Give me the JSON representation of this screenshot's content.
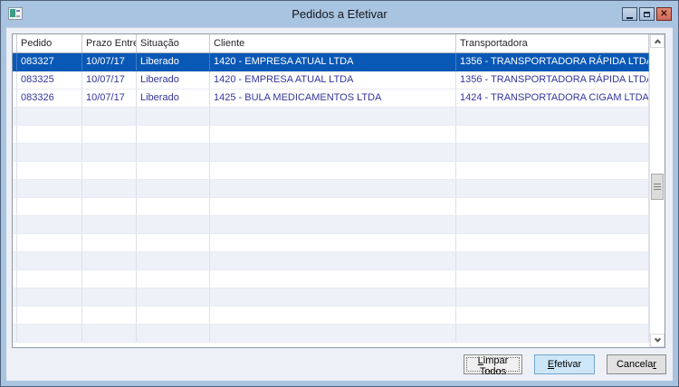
{
  "window": {
    "title": "Pedidos a Efetivar",
    "close_glyph": "✕"
  },
  "table": {
    "columns": [
      {
        "key": "indicator",
        "label": ""
      },
      {
        "key": "pedido",
        "label": "Pedido"
      },
      {
        "key": "prazo_entrega",
        "label": "Prazo Entrega"
      },
      {
        "key": "situacao",
        "label": "Situação"
      },
      {
        "key": "cliente",
        "label": "Cliente"
      },
      {
        "key": "transportadora",
        "label": "Transportadora"
      }
    ],
    "rows": [
      {
        "pedido": "083327",
        "prazo_entrega": "10/07/17",
        "situacao": "Liberado",
        "cliente": "1420 - EMPRESA ATUAL LTDA",
        "transportadora": "1356 - TRANSPORTADORA RÁPIDA LTDA",
        "selected": true
      },
      {
        "pedido": "083325",
        "prazo_entrega": "10/07/17",
        "situacao": "Liberado",
        "cliente": "1420 - EMPRESA ATUAL LTDA",
        "transportadora": "1356 - TRANSPORTADORA RÁPIDA LTDA",
        "selected": false
      },
      {
        "pedido": "083326",
        "prazo_entrega": "10/07/17",
        "situacao": "Liberado",
        "cliente": "1425 - BULA MEDICAMENTOS LTDA",
        "transportadora": "1424 - TRANSPORTADORA CIGAM LTDA",
        "selected": false
      }
    ],
    "empty_row_count": 13
  },
  "buttons": {
    "limpar_todos": {
      "pre": "",
      "accel": "L",
      "post": "impar Todos"
    },
    "efetivar": {
      "pre": "",
      "accel": "E",
      "post": "fetivar"
    },
    "cancelar": {
      "pre": "Cancela",
      "accel": "r",
      "post": ""
    }
  },
  "colors": {
    "titlebar": "#a9c4e0",
    "selection": "#0a58b6",
    "row_text": "#34349e",
    "default_button": "#cde7f8"
  }
}
